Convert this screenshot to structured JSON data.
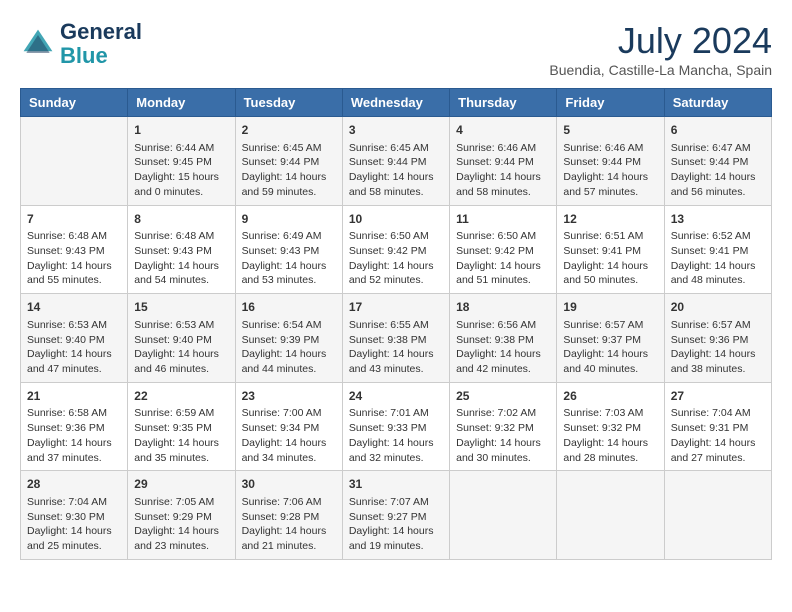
{
  "header": {
    "logo_line1": "General",
    "logo_line2": "Blue",
    "month_title": "July 2024",
    "location": "Buendia, Castille-La Mancha, Spain"
  },
  "weekdays": [
    "Sunday",
    "Monday",
    "Tuesday",
    "Wednesday",
    "Thursday",
    "Friday",
    "Saturday"
  ],
  "weeks": [
    [
      {
        "day": "",
        "content": ""
      },
      {
        "day": "1",
        "content": "Sunrise: 6:44 AM\nSunset: 9:45 PM\nDaylight: 15 hours\nand 0 minutes."
      },
      {
        "day": "2",
        "content": "Sunrise: 6:45 AM\nSunset: 9:44 PM\nDaylight: 14 hours\nand 59 minutes."
      },
      {
        "day": "3",
        "content": "Sunrise: 6:45 AM\nSunset: 9:44 PM\nDaylight: 14 hours\nand 58 minutes."
      },
      {
        "day": "4",
        "content": "Sunrise: 6:46 AM\nSunset: 9:44 PM\nDaylight: 14 hours\nand 58 minutes."
      },
      {
        "day": "5",
        "content": "Sunrise: 6:46 AM\nSunset: 9:44 PM\nDaylight: 14 hours\nand 57 minutes."
      },
      {
        "day": "6",
        "content": "Sunrise: 6:47 AM\nSunset: 9:44 PM\nDaylight: 14 hours\nand 56 minutes."
      }
    ],
    [
      {
        "day": "7",
        "content": "Sunrise: 6:48 AM\nSunset: 9:43 PM\nDaylight: 14 hours\nand 55 minutes."
      },
      {
        "day": "8",
        "content": "Sunrise: 6:48 AM\nSunset: 9:43 PM\nDaylight: 14 hours\nand 54 minutes."
      },
      {
        "day": "9",
        "content": "Sunrise: 6:49 AM\nSunset: 9:43 PM\nDaylight: 14 hours\nand 53 minutes."
      },
      {
        "day": "10",
        "content": "Sunrise: 6:50 AM\nSunset: 9:42 PM\nDaylight: 14 hours\nand 52 minutes."
      },
      {
        "day": "11",
        "content": "Sunrise: 6:50 AM\nSunset: 9:42 PM\nDaylight: 14 hours\nand 51 minutes."
      },
      {
        "day": "12",
        "content": "Sunrise: 6:51 AM\nSunset: 9:41 PM\nDaylight: 14 hours\nand 50 minutes."
      },
      {
        "day": "13",
        "content": "Sunrise: 6:52 AM\nSunset: 9:41 PM\nDaylight: 14 hours\nand 48 minutes."
      }
    ],
    [
      {
        "day": "14",
        "content": "Sunrise: 6:53 AM\nSunset: 9:40 PM\nDaylight: 14 hours\nand 47 minutes."
      },
      {
        "day": "15",
        "content": "Sunrise: 6:53 AM\nSunset: 9:40 PM\nDaylight: 14 hours\nand 46 minutes."
      },
      {
        "day": "16",
        "content": "Sunrise: 6:54 AM\nSunset: 9:39 PM\nDaylight: 14 hours\nand 44 minutes."
      },
      {
        "day": "17",
        "content": "Sunrise: 6:55 AM\nSunset: 9:38 PM\nDaylight: 14 hours\nand 43 minutes."
      },
      {
        "day": "18",
        "content": "Sunrise: 6:56 AM\nSunset: 9:38 PM\nDaylight: 14 hours\nand 42 minutes."
      },
      {
        "day": "19",
        "content": "Sunrise: 6:57 AM\nSunset: 9:37 PM\nDaylight: 14 hours\nand 40 minutes."
      },
      {
        "day": "20",
        "content": "Sunrise: 6:57 AM\nSunset: 9:36 PM\nDaylight: 14 hours\nand 38 minutes."
      }
    ],
    [
      {
        "day": "21",
        "content": "Sunrise: 6:58 AM\nSunset: 9:36 PM\nDaylight: 14 hours\nand 37 minutes."
      },
      {
        "day": "22",
        "content": "Sunrise: 6:59 AM\nSunset: 9:35 PM\nDaylight: 14 hours\nand 35 minutes."
      },
      {
        "day": "23",
        "content": "Sunrise: 7:00 AM\nSunset: 9:34 PM\nDaylight: 14 hours\nand 34 minutes."
      },
      {
        "day": "24",
        "content": "Sunrise: 7:01 AM\nSunset: 9:33 PM\nDaylight: 14 hours\nand 32 minutes."
      },
      {
        "day": "25",
        "content": "Sunrise: 7:02 AM\nSunset: 9:32 PM\nDaylight: 14 hours\nand 30 minutes."
      },
      {
        "day": "26",
        "content": "Sunrise: 7:03 AM\nSunset: 9:32 PM\nDaylight: 14 hours\nand 28 minutes."
      },
      {
        "day": "27",
        "content": "Sunrise: 7:04 AM\nSunset: 9:31 PM\nDaylight: 14 hours\nand 27 minutes."
      }
    ],
    [
      {
        "day": "28",
        "content": "Sunrise: 7:04 AM\nSunset: 9:30 PM\nDaylight: 14 hours\nand 25 minutes."
      },
      {
        "day": "29",
        "content": "Sunrise: 7:05 AM\nSunset: 9:29 PM\nDaylight: 14 hours\nand 23 minutes."
      },
      {
        "day": "30",
        "content": "Sunrise: 7:06 AM\nSunset: 9:28 PM\nDaylight: 14 hours\nand 21 minutes."
      },
      {
        "day": "31",
        "content": "Sunrise: 7:07 AM\nSunset: 9:27 PM\nDaylight: 14 hours\nand 19 minutes."
      },
      {
        "day": "",
        "content": ""
      },
      {
        "day": "",
        "content": ""
      },
      {
        "day": "",
        "content": ""
      }
    ]
  ]
}
